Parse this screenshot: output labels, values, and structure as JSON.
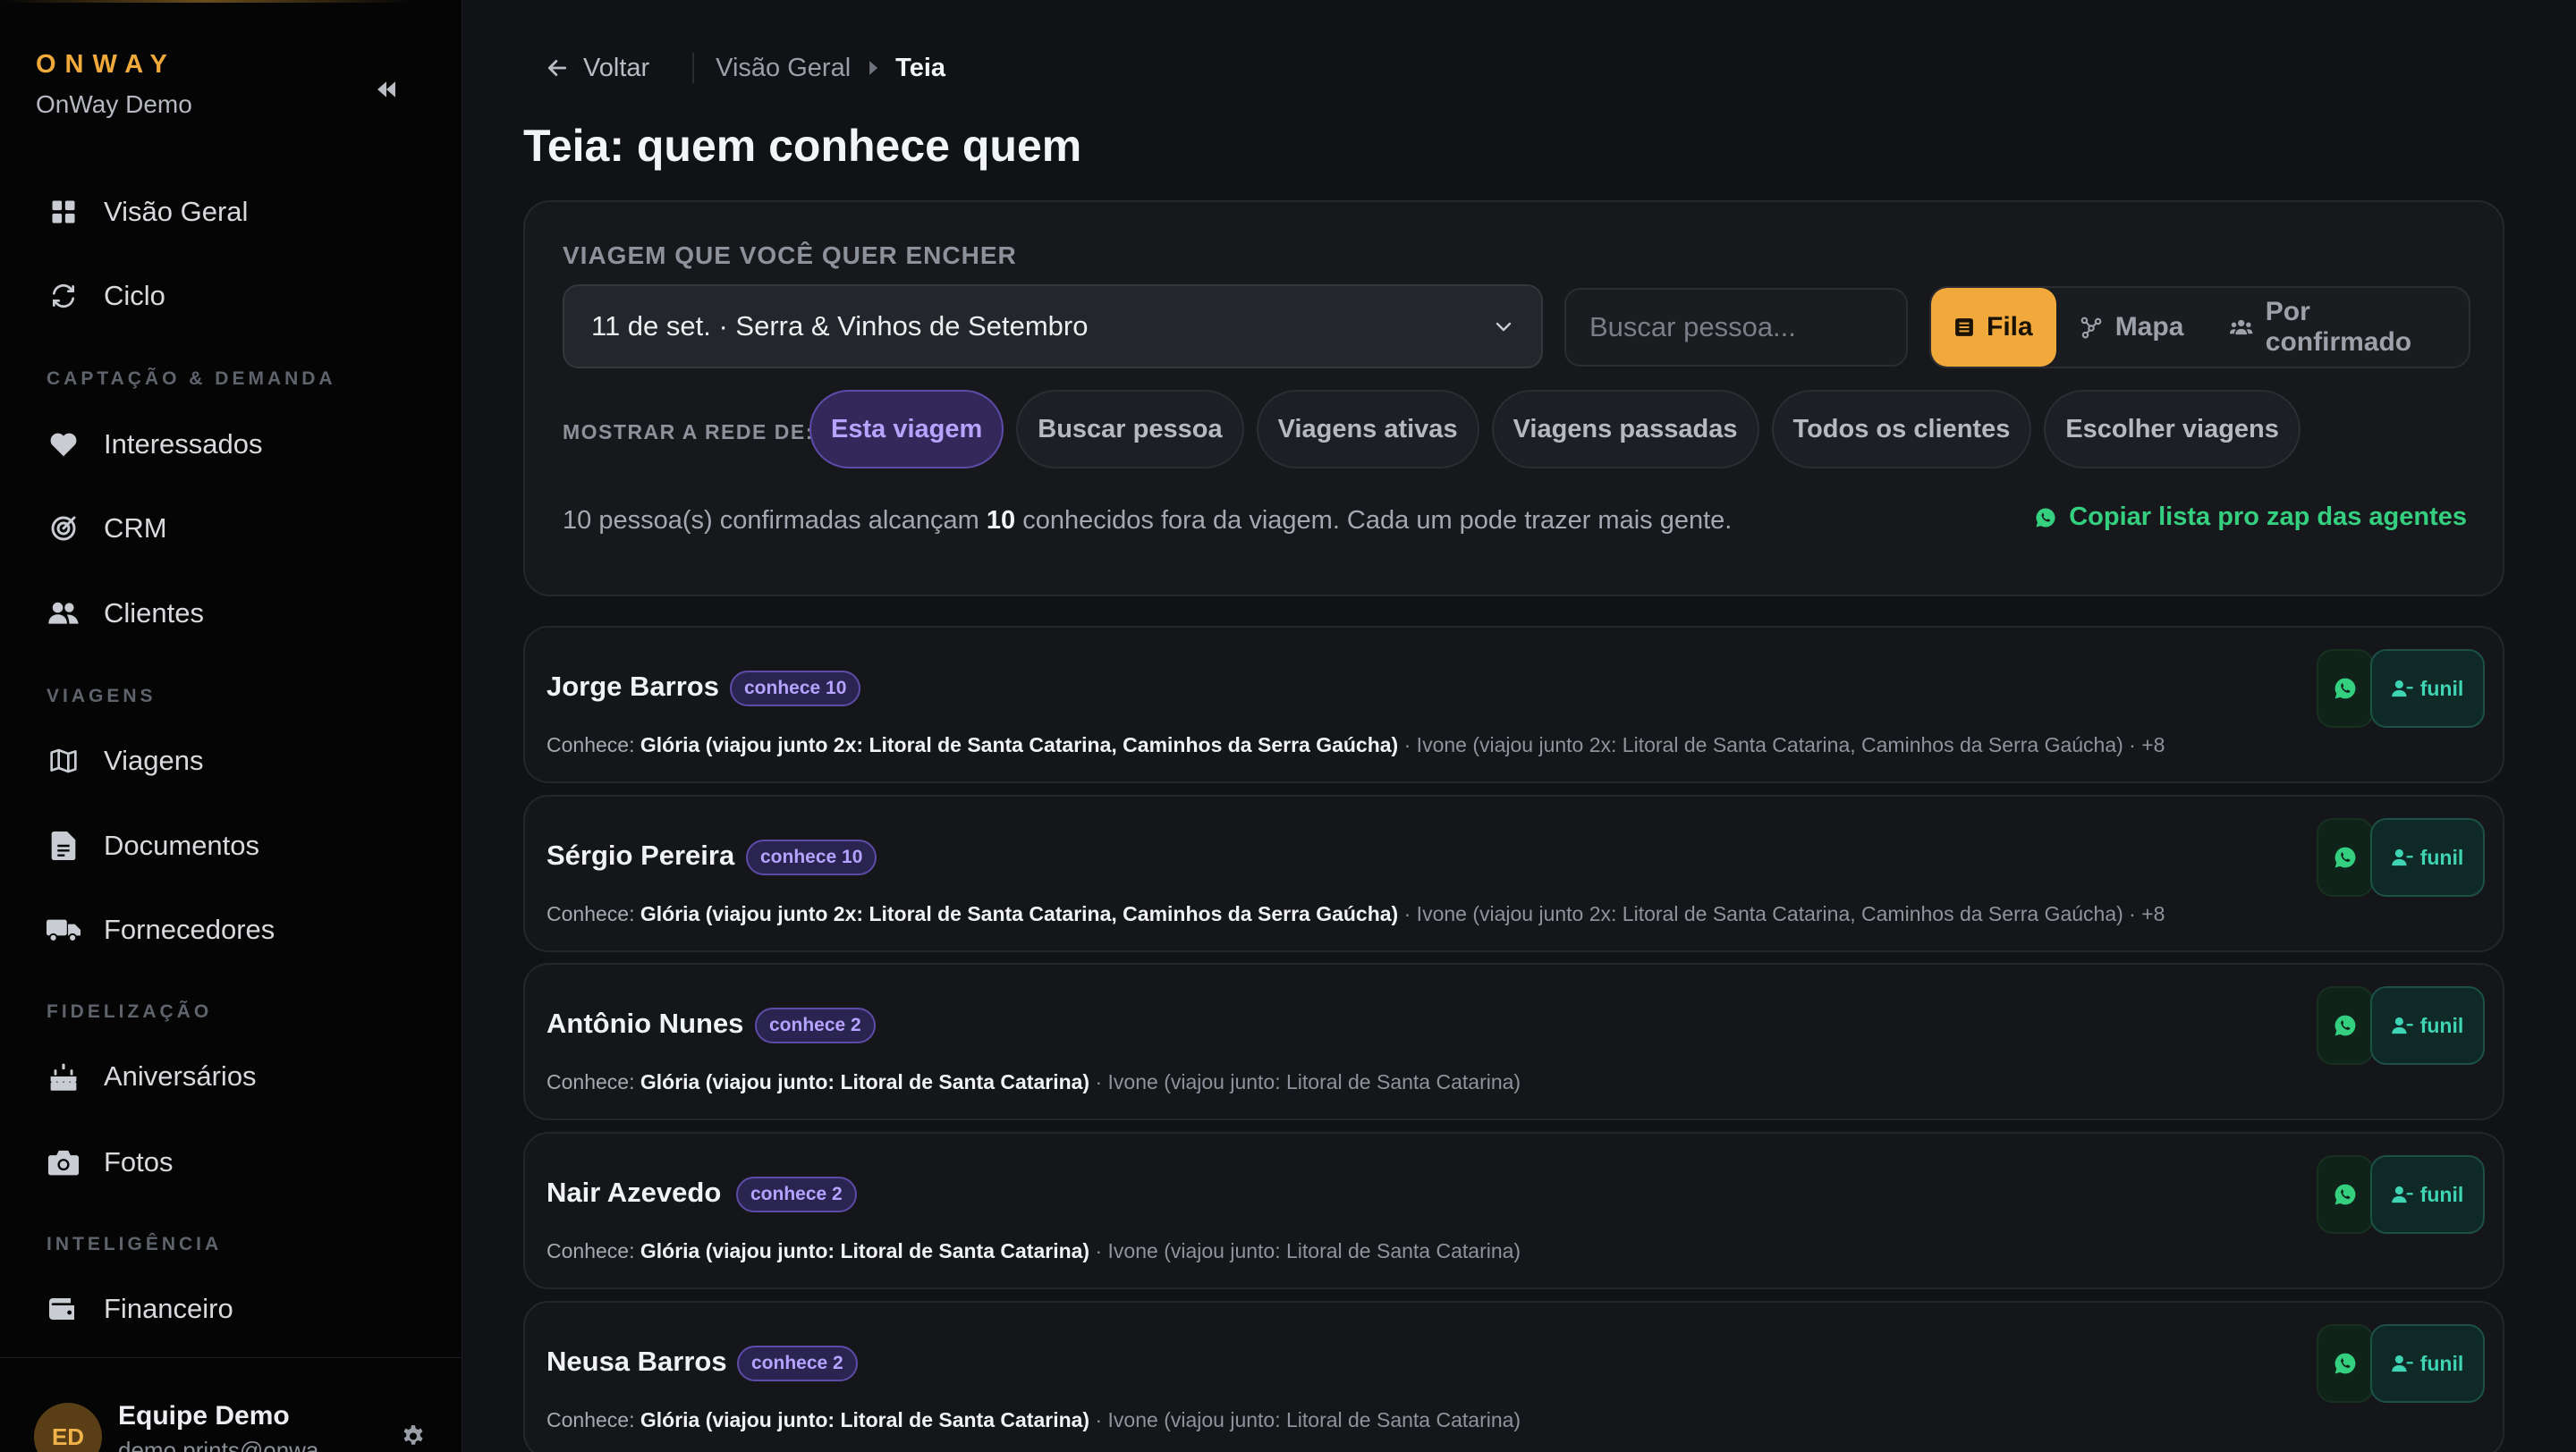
{
  "brand": {
    "logo": "ONWAY",
    "subtitle": "OnWay Demo"
  },
  "sidebar": {
    "items": [
      {
        "label": "Visão Geral",
        "icon": "grid-icon"
      },
      {
        "label": "Ciclo",
        "icon": "cycle-icon"
      },
      {
        "label": "Interessados",
        "icon": "heart-icon"
      },
      {
        "label": "CRM",
        "icon": "target-icon"
      },
      {
        "label": "Clientes",
        "icon": "users-icon"
      },
      {
        "label": "Viagens",
        "icon": "map-icon"
      },
      {
        "label": "Documentos",
        "icon": "document-icon"
      },
      {
        "label": "Fornecedores",
        "icon": "truck-icon"
      },
      {
        "label": "Aniversários",
        "icon": "cake-icon"
      },
      {
        "label": "Fotos",
        "icon": "camera-icon"
      },
      {
        "label": "Financeiro",
        "icon": "wallet-icon"
      }
    ],
    "sections": {
      "captacao": "CAPTAÇÃO & DEMANDA",
      "viagens": "VIAGENS",
      "fidelizacao": "FIDELIZAÇÃO",
      "inteligencia": "INTELIGÊNCIA"
    },
    "footer": {
      "initials": "ED",
      "name": "Equipe Demo",
      "email": "demo.prints@onwa"
    }
  },
  "topbar": {
    "back": "Voltar",
    "crumb_parent": "Visão Geral",
    "crumb_current": "Teia"
  },
  "page": {
    "title": "Teia: quem conhece quem"
  },
  "filter": {
    "label": "VIAGEM QUE VOCÊ QUER ENCHER",
    "selected_trip": "11 de set. · Serra & Vinhos de Setembro",
    "search_placeholder": "Buscar pessoa...",
    "views": {
      "fila": "Fila",
      "mapa": "Mapa",
      "confirmado": "Por confirmado"
    },
    "network_label": "MOSTRAR A REDE DE:",
    "chips": {
      "esta": "Esta viagem",
      "buscar": "Buscar pessoa",
      "ativas": "Viagens ativas",
      "passadas": "Viagens passadas",
      "todos": "Todos os clientes",
      "escolher": "Escolher viagens"
    },
    "summary_pre": "10 pessoa(s) confirmadas alcançam",
    "summary_count": "10",
    "summary_post": "conhecidos fora da viagem. Cada um pode trazer mais gente.",
    "copy_label": "Copiar lista pro zap das agentes"
  },
  "accent": {
    "orange": "#f0a93a",
    "purple": "#b8a3ff",
    "green": "#35d07f",
    "teal": "#3fd4b4"
  },
  "people": [
    {
      "name": "Jorge Barros",
      "badge": "conhece 10",
      "knows_label": "Conhece:",
      "first": "Glória (viajou junto 2x: Litoral de Santa Catarina, Caminhos da Serra Gaúcha)",
      "rest": " · Ivone (viajou junto 2x: Litoral de Santa Catarina, Caminhos da Serra Gaúcha) · +8",
      "funil": "funil"
    },
    {
      "name": "Sérgio Pereira",
      "badge": "conhece 10",
      "knows_label": "Conhece:",
      "first": "Glória (viajou junto 2x: Litoral de Santa Catarina, Caminhos da Serra Gaúcha)",
      "rest": " · Ivone (viajou junto 2x: Litoral de Santa Catarina, Caminhos da Serra Gaúcha) · +8",
      "funil": "funil"
    },
    {
      "name": "Antônio Nunes",
      "badge": "conhece 2",
      "knows_label": "Conhece:",
      "first": "Glória (viajou junto: Litoral de Santa Catarina)",
      "rest": " · Ivone (viajou junto: Litoral de Santa Catarina)",
      "funil": "funil"
    },
    {
      "name": "Nair Azevedo",
      "badge": "conhece 2",
      "knows_label": "Conhece:",
      "first": "Glória (viajou junto: Litoral de Santa Catarina)",
      "rest": " · Ivone (viajou junto: Litoral de Santa Catarina)",
      "funil": "funil"
    },
    {
      "name": "Neusa Barros",
      "badge": "conhece 2",
      "knows_label": "Conhece:",
      "first": "Glória (viajou junto: Litoral de Santa Catarina)",
      "rest": " · Ivone (viajou junto: Litoral de Santa Catarina)",
      "funil": "funil"
    }
  ]
}
